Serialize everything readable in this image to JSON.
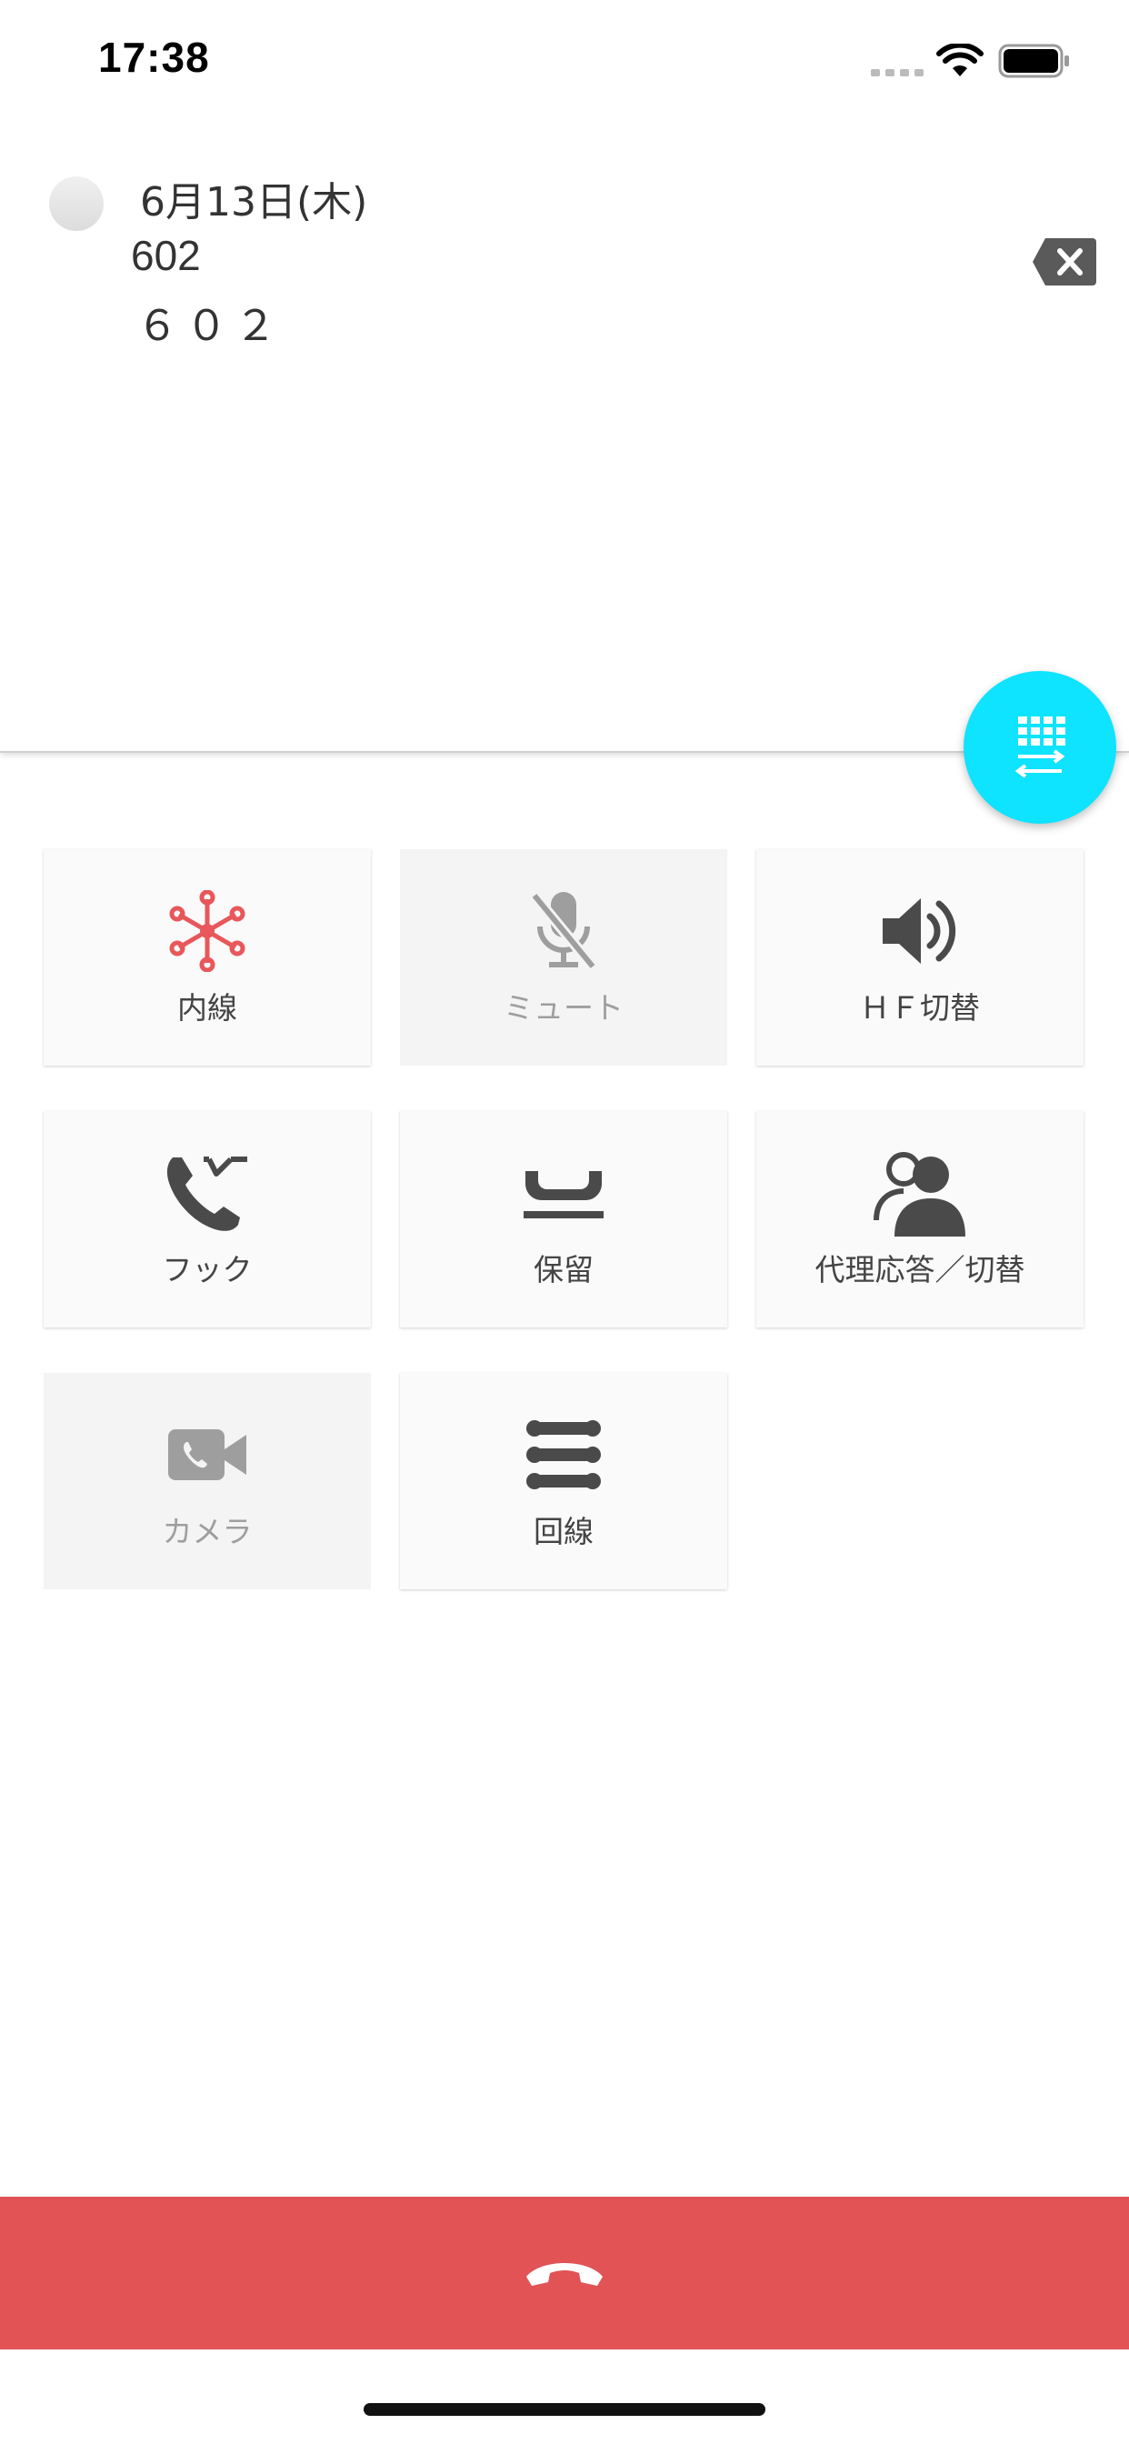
{
  "status_bar": {
    "time": "17:38"
  },
  "call": {
    "date": "6月13日(木)",
    "number": "602",
    "name": "６０２"
  },
  "buttons": [
    {
      "id": "extension",
      "label": "内線",
      "icon": "extension-network-icon",
      "enabled": true,
      "icon_color": "#e8575a"
    },
    {
      "id": "mute",
      "label": "ミュート",
      "icon": "mic-off-icon",
      "enabled": false
    },
    {
      "id": "hf",
      "label": "ＨＦ切替",
      "icon": "speaker-icon",
      "enabled": true
    },
    {
      "id": "hook",
      "label": "フック",
      "icon": "hook-phone-icon",
      "enabled": true
    },
    {
      "id": "hold",
      "label": "保留",
      "icon": "hold-icon",
      "enabled": true
    },
    {
      "id": "pickup",
      "label": "代理応答／切替",
      "icon": "pickup-users-icon",
      "enabled": true
    },
    {
      "id": "camera",
      "label": "カメラ",
      "icon": "video-camera-icon",
      "enabled": false
    },
    {
      "id": "line",
      "label": "回線",
      "icon": "lines-icon",
      "enabled": true
    }
  ],
  "colors": {
    "accent": "#0ee3ff",
    "end_call": "#e15355",
    "extension_icon": "#e8575a",
    "icon": "#4a4a4a",
    "disabled_icon": "#9e9e9e"
  }
}
